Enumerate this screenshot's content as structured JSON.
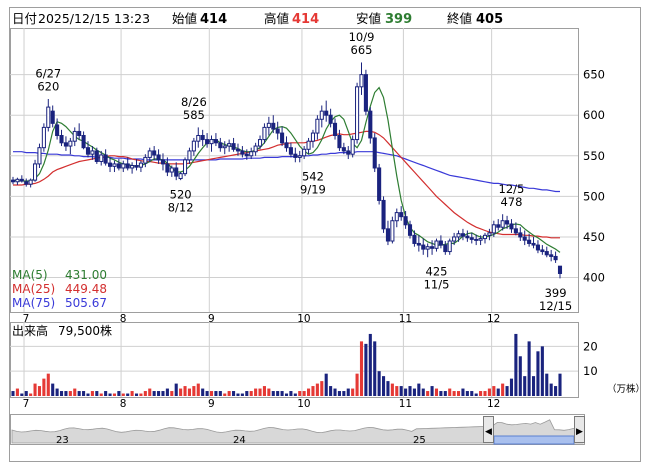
{
  "header": {
    "date_label": "日付",
    "date_value": "2025/12/15 13:23",
    "open_label": "始値",
    "open_value": "414",
    "high_label": "高値",
    "high_value": "414",
    "low_label": "安値",
    "low_value": "399",
    "close_label": "終値",
    "close_value": "405"
  },
  "colors": {
    "up": "#1a237e",
    "down": "#1a237e",
    "ma5": "#2e7d32",
    "ma25": "#d32f2f",
    "ma75": "#3a3ad8",
    "vol_up": "#e53935",
    "vol_down": "#1a237e",
    "high_value": "#e53935",
    "low_value": "#2e7d32",
    "grid": "#d0d0d0"
  },
  "legend": {
    "ma5_label": "MA(5)",
    "ma5_value": "431.00",
    "ma25_label": "MA(25)",
    "ma25_value": "449.48",
    "ma75_label": "MA(75)",
    "ma75_value": "505.67"
  },
  "volume": {
    "label": "出来高",
    "value": "79,500株",
    "unit": "（万株）"
  },
  "navigator": {
    "year_labels": [
      "23",
      "24",
      "25"
    ],
    "left_arrow": "◀",
    "right_arrow": "▶"
  },
  "chart_data": {
    "type": "candlestick",
    "price_ylim": [
      360,
      705
    ],
    "price_ticks": [
      400,
      450,
      500,
      550,
      600,
      650
    ],
    "volume_ylim": [
      0,
      29
    ],
    "volume_ticks": [
      10,
      20
    ],
    "months": [
      {
        "label": "7",
        "index": 3
      },
      {
        "label": "8",
        "index": 25
      },
      {
        "label": "9",
        "index": 45
      },
      {
        "label": "10",
        "index": 66
      },
      {
        "label": "11",
        "index": 89
      },
      {
        "label": "12",
        "index": 109
      }
    ],
    "annotations": [
      {
        "index": 8,
        "price": 623,
        "lines": [
          "6/27",
          "620"
        ],
        "pos": "above"
      },
      {
        "index": 41,
        "price": 588,
        "lines": [
          "8/26",
          "585"
        ],
        "pos": "above"
      },
      {
        "index": 79,
        "price": 668,
        "lines": [
          "10/9",
          "665"
        ],
        "pos": "above"
      },
      {
        "index": 113,
        "price": 481,
        "lines": [
          "12/5",
          "478"
        ],
        "pos": "above"
      },
      {
        "index": 38,
        "price": 517,
        "lines": [
          "520",
          "8/12"
        ],
        "pos": "below"
      },
      {
        "index": 68,
        "price": 539,
        "lines": [
          "542",
          "9/19"
        ],
        "pos": "below"
      },
      {
        "index": 96,
        "price": 422,
        "lines": [
          "425",
          "11/5"
        ],
        "pos": "below"
      },
      {
        "index": 123,
        "price": 396,
        "lines": [
          "399",
          "12/15"
        ],
        "pos": "below"
      }
    ],
    "ohlc": [
      [
        520,
        524,
        515,
        518
      ],
      [
        518,
        523,
        514,
        521
      ],
      [
        521,
        526,
        517,
        519
      ],
      [
        518,
        522,
        512,
        515
      ],
      [
        515,
        522,
        511,
        520
      ],
      [
        520,
        545,
        518,
        540
      ],
      [
        540,
        565,
        535,
        560
      ],
      [
        560,
        590,
        555,
        585
      ],
      [
        585,
        620,
        580,
        610
      ],
      [
        605,
        612,
        585,
        590
      ],
      [
        588,
        596,
        570,
        575
      ],
      [
        575,
        582,
        562,
        566
      ],
      [
        566,
        574,
        556,
        562
      ],
      [
        562,
        572,
        552,
        568
      ],
      [
        568,
        585,
        562,
        580
      ],
      [
        580,
        590,
        570,
        575
      ],
      [
        575,
        580,
        558,
        560
      ],
      [
        560,
        568,
        548,
        552
      ],
      [
        552,
        562,
        545,
        556
      ],
      [
        556,
        560,
        540,
        543
      ],
      [
        543,
        556,
        538,
        551
      ],
      [
        551,
        558,
        538,
        541
      ],
      [
        541,
        548,
        530,
        537
      ],
      [
        537,
        544,
        530,
        540
      ],
      [
        540,
        546,
        532,
        535
      ],
      [
        535,
        544,
        530,
        540
      ],
      [
        540,
        548,
        532,
        535
      ],
      [
        535,
        542,
        528,
        538
      ],
      [
        538,
        546,
        532,
        536
      ],
      [
        536,
        544,
        530,
        541
      ],
      [
        541,
        552,
        536,
        548
      ],
      [
        548,
        560,
        542,
        556
      ],
      [
        556,
        562,
        545,
        551
      ],
      [
        551,
        558,
        540,
        545
      ],
      [
        545,
        553,
        532,
        540
      ],
      [
        540,
        548,
        525,
        530
      ],
      [
        530,
        538,
        524,
        535
      ],
      [
        535,
        542,
        520,
        525
      ],
      [
        522,
        530,
        520,
        528
      ],
      [
        528,
        548,
        525,
        545
      ],
      [
        545,
        560,
        540,
        556
      ],
      [
        556,
        572,
        550,
        568
      ],
      [
        568,
        585,
        560,
        575
      ],
      [
        575,
        582,
        562,
        570
      ],
      [
        570,
        578,
        560,
        565
      ],
      [
        565,
        575,
        555,
        570
      ],
      [
        570,
        578,
        562,
        566
      ],
      [
        566,
        572,
        555,
        560
      ],
      [
        560,
        568,
        552,
        562
      ],
      [
        562,
        570,
        555,
        565
      ],
      [
        565,
        572,
        555,
        558
      ],
      [
        558,
        565,
        550,
        556
      ],
      [
        556,
        562,
        548,
        552
      ],
      [
        552,
        558,
        545,
        550
      ],
      [
        550,
        560,
        546,
        555
      ],
      [
        555,
        566,
        550,
        562
      ],
      [
        562,
        575,
        558,
        570
      ],
      [
        570,
        590,
        565,
        585
      ],
      [
        585,
        598,
        575,
        590
      ],
      [
        590,
        600,
        578,
        583
      ],
      [
        583,
        592,
        570,
        578
      ],
      [
        578,
        586,
        562,
        566
      ],
      [
        566,
        574,
        555,
        560
      ],
      [
        560,
        566,
        548,
        552
      ],
      [
        552,
        560,
        542,
        548
      ],
      [
        548,
        556,
        542,
        550
      ],
      [
        550,
        562,
        546,
        558
      ],
      [
        558,
        572,
        552,
        568
      ],
      [
        568,
        582,
        560,
        578
      ],
      [
        578,
        600,
        570,
        595
      ],
      [
        595,
        612,
        585,
        605
      ],
      [
        605,
        618,
        592,
        600
      ],
      [
        600,
        608,
        585,
        590
      ],
      [
        590,
        596,
        570,
        575
      ],
      [
        575,
        582,
        556,
        560
      ],
      [
        560,
        566,
        552,
        556
      ],
      [
        556,
        562,
        546,
        552
      ],
      [
        552,
        575,
        548,
        570
      ],
      [
        570,
        640,
        565,
        635
      ],
      [
        635,
        665,
        625,
        650
      ],
      [
        650,
        656,
        600,
        605
      ],
      [
        605,
        610,
        565,
        572
      ],
      [
        572,
        578,
        530,
        535
      ],
      [
        535,
        540,
        490,
        495
      ],
      [
        495,
        500,
        455,
        460
      ],
      [
        460,
        470,
        440,
        445
      ],
      [
        445,
        475,
        442,
        470
      ],
      [
        470,
        485,
        462,
        480
      ],
      [
        480,
        488,
        470,
        475
      ],
      [
        475,
        482,
        460,
        465
      ],
      [
        465,
        470,
        448,
        452
      ],
      [
        452,
        458,
        438,
        442
      ],
      [
        442,
        452,
        432,
        440
      ],
      [
        440,
        448,
        428,
        435
      ],
      [
        435,
        442,
        425,
        438
      ],
      [
        438,
        446,
        428,
        436
      ],
      [
        436,
        448,
        432,
        445
      ],
      [
        445,
        452,
        436,
        440
      ],
      [
        440,
        445,
        428,
        432
      ],
      [
        432,
        448,
        428,
        445
      ],
      [
        445,
        455,
        440,
        450
      ],
      [
        450,
        458,
        444,
        454
      ],
      [
        454,
        460,
        446,
        451
      ],
      [
        451,
        458,
        444,
        449
      ],
      [
        449,
        455,
        442,
        447
      ],
      [
        447,
        453,
        440,
        446
      ],
      [
        446,
        452,
        440,
        448
      ],
      [
        448,
        455,
        442,
        452
      ],
      [
        452,
        460,
        446,
        455
      ],
      [
        455,
        470,
        450,
        465
      ],
      [
        465,
        472,
        458,
        462
      ],
      [
        462,
        478,
        458,
        470
      ],
      [
        470,
        476,
        460,
        466
      ],
      [
        466,
        472,
        455,
        460
      ],
      [
        460,
        468,
        452,
        455
      ],
      [
        455,
        462,
        445,
        450
      ],
      [
        450,
        458,
        440,
        446
      ],
      [
        446,
        454,
        438,
        442
      ],
      [
        442,
        450,
        436,
        440
      ],
      [
        440,
        446,
        430,
        434
      ],
      [
        434,
        440,
        428,
        432
      ],
      [
        432,
        438,
        425,
        428
      ],
      [
        428,
        434,
        420,
        426
      ],
      [
        426,
        432,
        418,
        422
      ],
      [
        414,
        414,
        399,
        405
      ]
    ],
    "volume_values": [
      2,
      3,
      1,
      2,
      1,
      5,
      4,
      7,
      9,
      5,
      3,
      2,
      2,
      2,
      3,
      2,
      2,
      1,
      2,
      2,
      1,
      2,
      1,
      1,
      2,
      1,
      1,
      2,
      1,
      1,
      2,
      3,
      2,
      2,
      2,
      3,
      2,
      5,
      3,
      4,
      3,
      4,
      5,
      3,
      2,
      2,
      2,
      2,
      1,
      2,
      2,
      1,
      1,
      2,
      2,
      3,
      3,
      4,
      3,
      2,
      2,
      2,
      1,
      2,
      1,
      2,
      2,
      3,
      4,
      5,
      6,
      9,
      4,
      3,
      2,
      2,
      3,
      3,
      9,
      22,
      21,
      25,
      22,
      10,
      8,
      6,
      5,
      4,
      4,
      3,
      4,
      3,
      5,
      3,
      2,
      4,
      3,
      2,
      2,
      3,
      2,
      2,
      3,
      2,
      2,
      1,
      2,
      2,
      3,
      4,
      3,
      5,
      4,
      7,
      25,
      16,
      8,
      22,
      8,
      18,
      20,
      9,
      5,
      4,
      9
    ],
    "ma5": [
      520,
      519,
      519,
      519,
      519,
      522,
      528,
      540,
      557,
      580,
      592,
      590,
      586,
      580,
      574,
      570,
      568,
      564,
      561,
      557,
      554,
      551,
      547,
      545,
      542,
      540,
      539,
      538,
      537,
      538,
      540,
      543,
      546,
      546,
      545,
      541,
      535,
      530,
      530,
      532,
      537,
      545,
      553,
      560,
      566,
      570,
      570,
      566,
      564,
      562,
      561,
      559,
      556,
      555,
      555,
      557,
      560,
      566,
      574,
      582,
      585,
      586,
      584,
      578,
      570,
      562,
      556,
      552,
      554,
      560,
      570,
      583,
      592,
      598,
      600,
      595,
      580,
      565,
      560,
      569,
      591,
      611,
      628,
      634,
      622,
      594,
      559,
      525,
      495,
      475,
      462,
      455,
      452,
      448,
      444,
      442,
      440,
      440,
      441,
      442,
      442,
      446,
      451,
      454,
      455,
      452,
      450,
      450,
      451,
      453,
      456,
      460,
      462,
      465,
      466,
      465,
      460,
      456,
      452,
      449,
      445,
      441,
      438,
      435,
      431
    ],
    "ma25": [
      514,
      514,
      514,
      515,
      515,
      516,
      518,
      521,
      525,
      530,
      533,
      535,
      537,
      539,
      541,
      543,
      544,
      545,
      546,
      547,
      548,
      549,
      550,
      550,
      549,
      549,
      548,
      546,
      545,
      544,
      543,
      543,
      542,
      541,
      541,
      540,
      540,
      540,
      540,
      540,
      541,
      542,
      543,
      544,
      545,
      546,
      547,
      548,
      549,
      550,
      551,
      552,
      553,
      554,
      555,
      556,
      557,
      558,
      559,
      561,
      563,
      564,
      565,
      566,
      566,
      566,
      566,
      567,
      568,
      569,
      571,
      573,
      575,
      576,
      577,
      576,
      576,
      577,
      578,
      579,
      580,
      580,
      579,
      576,
      572,
      566,
      560,
      554,
      548,
      542,
      536,
      530,
      524,
      518,
      512,
      506,
      500,
      495,
      490,
      485,
      480,
      476,
      472,
      468,
      465,
      462,
      460,
      458,
      456,
      455,
      454,
      453,
      453,
      453,
      453,
      453,
      452,
      452,
      451,
      451,
      450,
      450,
      449,
      449,
      449
    ],
    "ma75": [
      555,
      555,
      555,
      554,
      554,
      554,
      553,
      553,
      552,
      552,
      552,
      551,
      551,
      551,
      550,
      550,
      549,
      549,
      549,
      548,
      548,
      548,
      548,
      547,
      547,
      547,
      546,
      546,
      546,
      546,
      545,
      545,
      545,
      545,
      545,
      545,
      545,
      545,
      545,
      545,
      545,
      545,
      545,
      545,
      545,
      545,
      545,
      546,
      546,
      546,
      546,
      546,
      546,
      547,
      547,
      547,
      547,
      548,
      548,
      548,
      548,
      549,
      549,
      549,
      549,
      550,
      550,
      550,
      551,
      551,
      552,
      552,
      553,
      553,
      554,
      554,
      554,
      554,
      555,
      555,
      555,
      555,
      555,
      554,
      553,
      552,
      551,
      550,
      548,
      546,
      544,
      542,
      540,
      538,
      536,
      534,
      532,
      530,
      528,
      526,
      525,
      524,
      523,
      522,
      521,
      520,
      519,
      518,
      517,
      516,
      516,
      515,
      514,
      514,
      513,
      512,
      511,
      510,
      510,
      509,
      508,
      508,
      507,
      506,
      506
    ]
  }
}
